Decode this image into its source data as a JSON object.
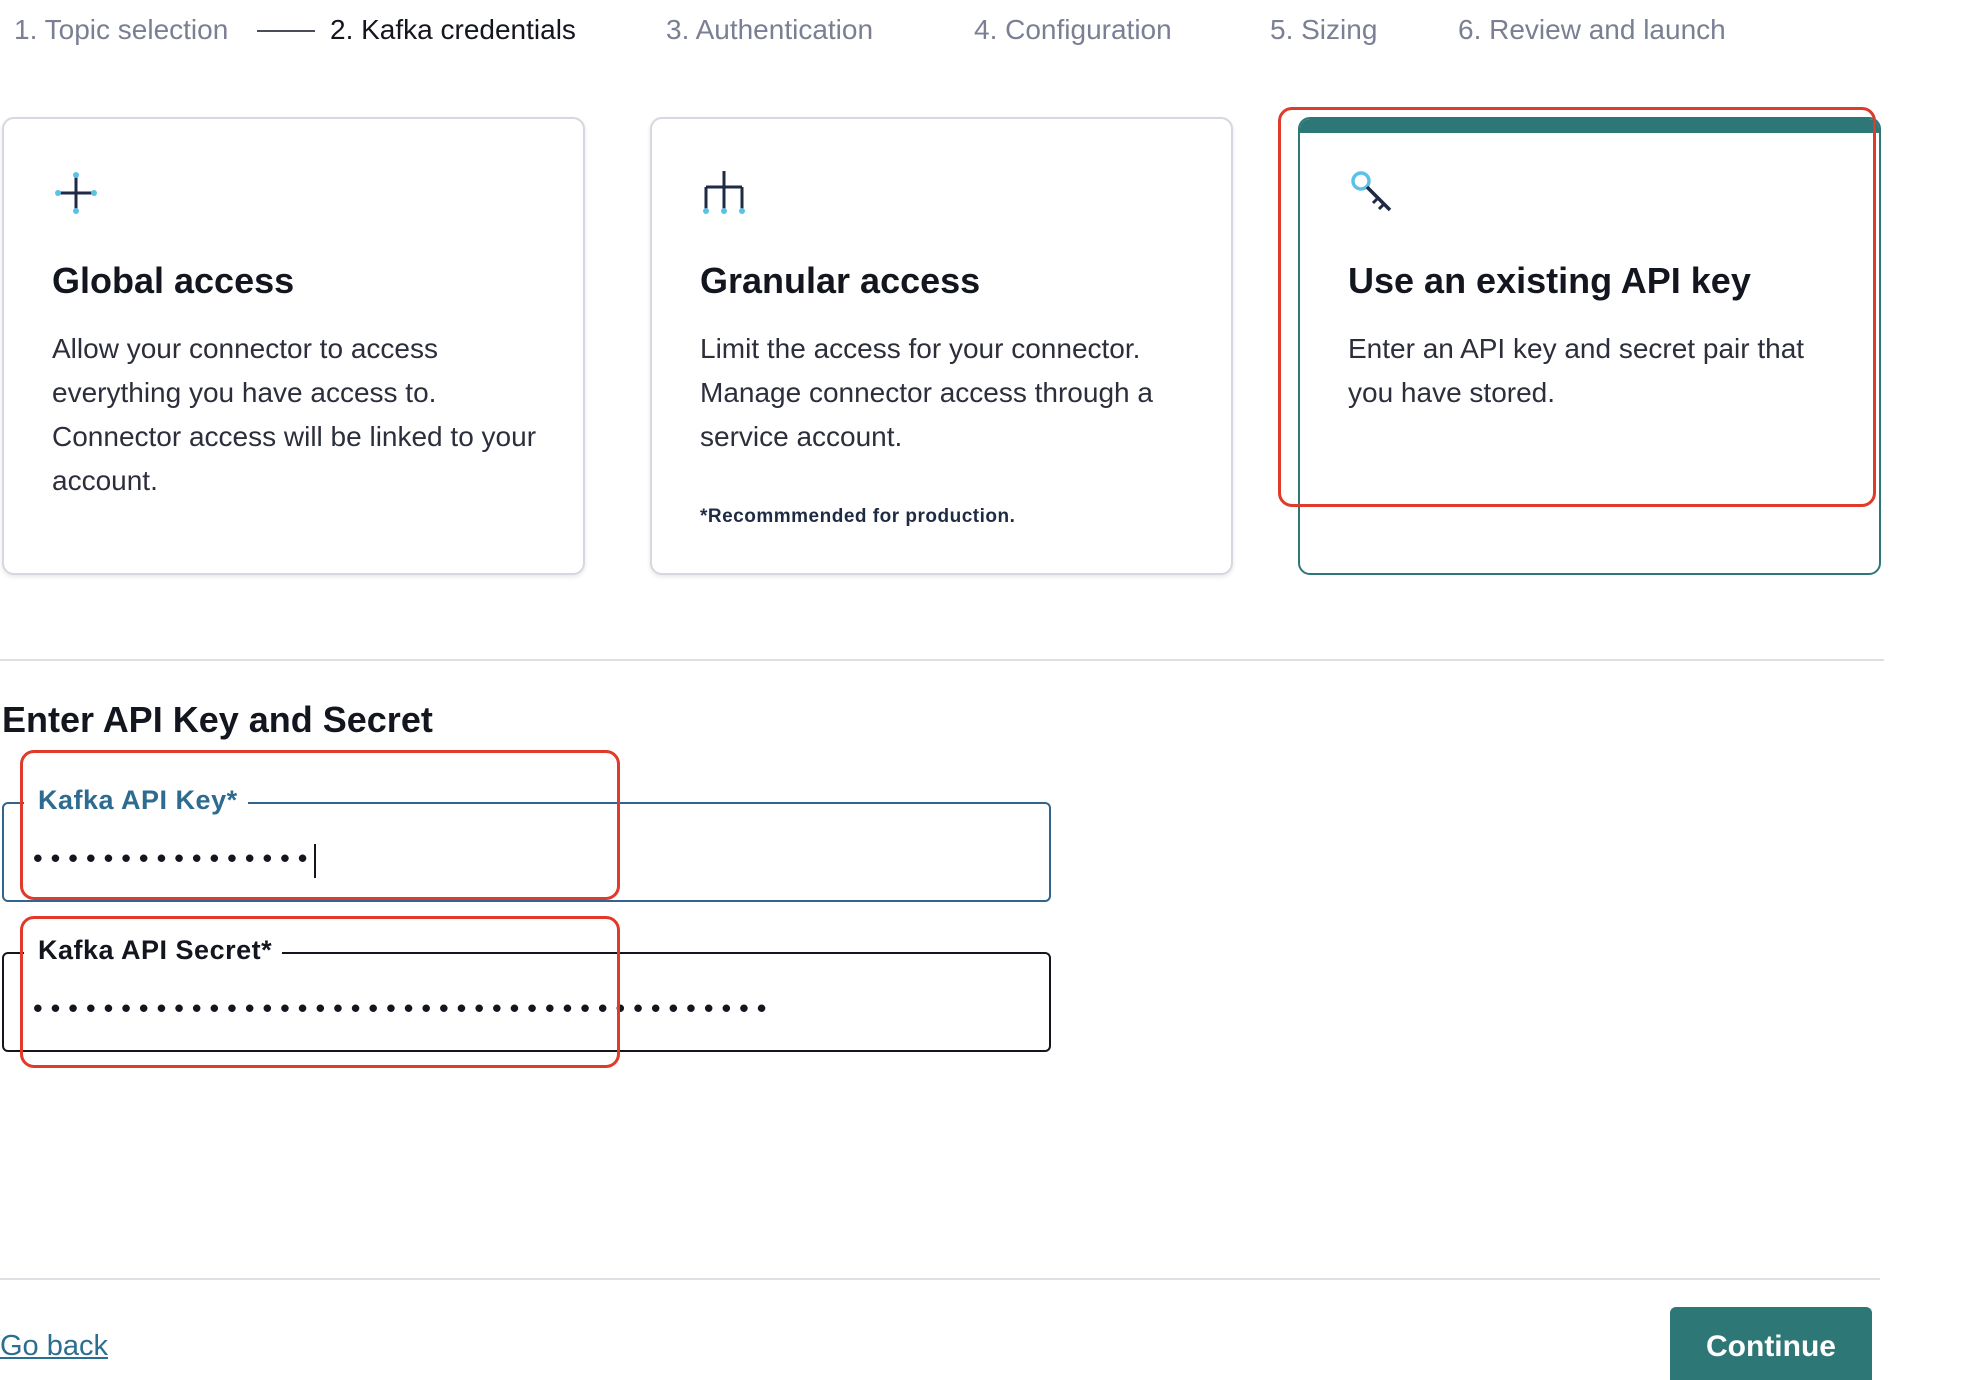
{
  "stepper": {
    "steps": [
      {
        "label": "1. Topic selection",
        "state": "completed"
      },
      {
        "label": "2. Kafka credentials",
        "state": "active"
      },
      {
        "label": "3. Authentication",
        "state": "upcoming"
      },
      {
        "label": "4. Configuration",
        "state": "upcoming"
      },
      {
        "label": "5. Sizing",
        "state": "upcoming"
      },
      {
        "label": "6. Review and launch",
        "state": "upcoming"
      }
    ]
  },
  "access_options": [
    {
      "icon": "crosshair-plus-icon",
      "title": "Global access",
      "description": "Allow your connector to access everything you have access to. Connector access will be linked to your account.",
      "selected": false
    },
    {
      "icon": "hierarchy-branch-icon",
      "title": "Granular access",
      "description": "Limit the access for your connector. Manage connector access through a service account.",
      "note": "*Recommmended for production.",
      "selected": false
    },
    {
      "icon": "key-icon",
      "title": "Use an existing API key",
      "description": "Enter an API key and secret pair that you have stored.",
      "selected": true
    }
  ],
  "api_section": {
    "title": "Enter API Key and Secret",
    "api_key": {
      "label": "Kafka API Key*",
      "value": "••••••••••••••••",
      "focused": true
    },
    "api_secret": {
      "label": "Kafka API Secret*",
      "value": "••••••••••••••••••••••••••••••••••••••••••",
      "focused": false
    }
  },
  "footer": {
    "back_label": "Go back",
    "continue_label": "Continue"
  },
  "colors": {
    "accent": "#2e7777",
    "focus_border": "#31658f",
    "link": "#2c6e8f",
    "annotation": "#e03a2a"
  }
}
